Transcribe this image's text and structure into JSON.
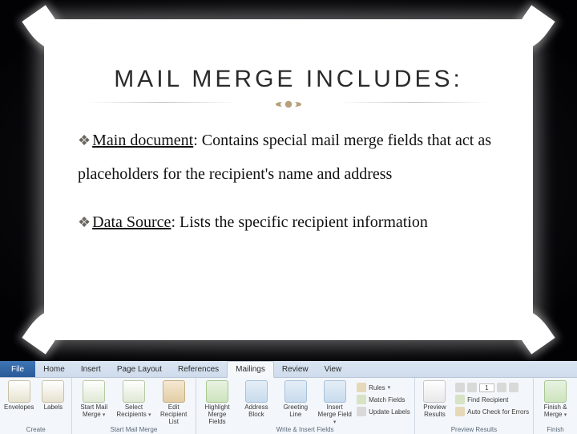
{
  "slide": {
    "title": "MAIL MERGE INCLUDES:",
    "bullets": [
      {
        "term": "Main document",
        "text": ":  Contains special mail merge fields that act as placeholders for the recipient's name and address"
      },
      {
        "term": "Data Source",
        "text": ":  Lists the specific recipient information"
      }
    ]
  },
  "ribbon": {
    "file": "File",
    "tabs": [
      "Home",
      "Insert",
      "Page Layout",
      "References",
      "Mailings",
      "Review",
      "View"
    ],
    "active_tab": "Mailings",
    "groups": {
      "create": {
        "label": "Create",
        "envelopes": "Envelopes",
        "labels": "Labels"
      },
      "start": {
        "label": "Start Mail Merge",
        "start": "Start Mail Merge",
        "select": "Select Recipients",
        "edit": "Edit Recipient List"
      },
      "write": {
        "label": "Write & Insert Fields",
        "highlight": "Highlight Merge Fields",
        "address": "Address Block",
        "greeting": "Greeting Line",
        "insert": "Insert Merge Field",
        "rules": "Rules",
        "match": "Match Fields",
        "update": "Update Labels"
      },
      "preview": {
        "label": "Preview Results",
        "preview": "Preview Results",
        "find": "Find Recipient",
        "auto": "Auto Check for Errors",
        "rec": "1"
      },
      "finish": {
        "label": "Finish",
        "finish": "Finish & Merge"
      }
    }
  }
}
